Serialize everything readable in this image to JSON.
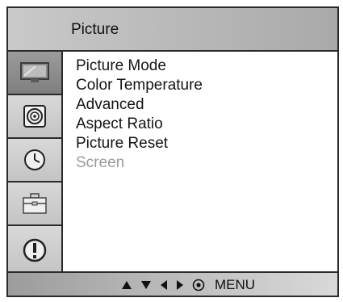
{
  "header": {
    "title": "Picture"
  },
  "sidebar": {
    "items": [
      {
        "icon": "tv-icon",
        "active": true
      },
      {
        "icon": "speaker-icon",
        "active": false
      },
      {
        "icon": "clock-icon",
        "active": false
      },
      {
        "icon": "toolbox-icon",
        "active": false
      },
      {
        "icon": "info-icon",
        "active": false
      }
    ]
  },
  "menu": {
    "items": [
      {
        "label": "Picture Mode",
        "enabled": true
      },
      {
        "label": "Color Temperature",
        "enabled": true
      },
      {
        "label": "Advanced",
        "enabled": true
      },
      {
        "label": "Aspect Ratio",
        "enabled": true
      },
      {
        "label": "Picture Reset",
        "enabled": true
      },
      {
        "label": "Screen",
        "enabled": false
      }
    ]
  },
  "footer": {
    "nav_icons": [
      "up-arrow-icon",
      "down-arrow-icon",
      "left-arrow-icon",
      "right-arrow-icon",
      "ok-icon"
    ],
    "menu_label": "MENU"
  }
}
